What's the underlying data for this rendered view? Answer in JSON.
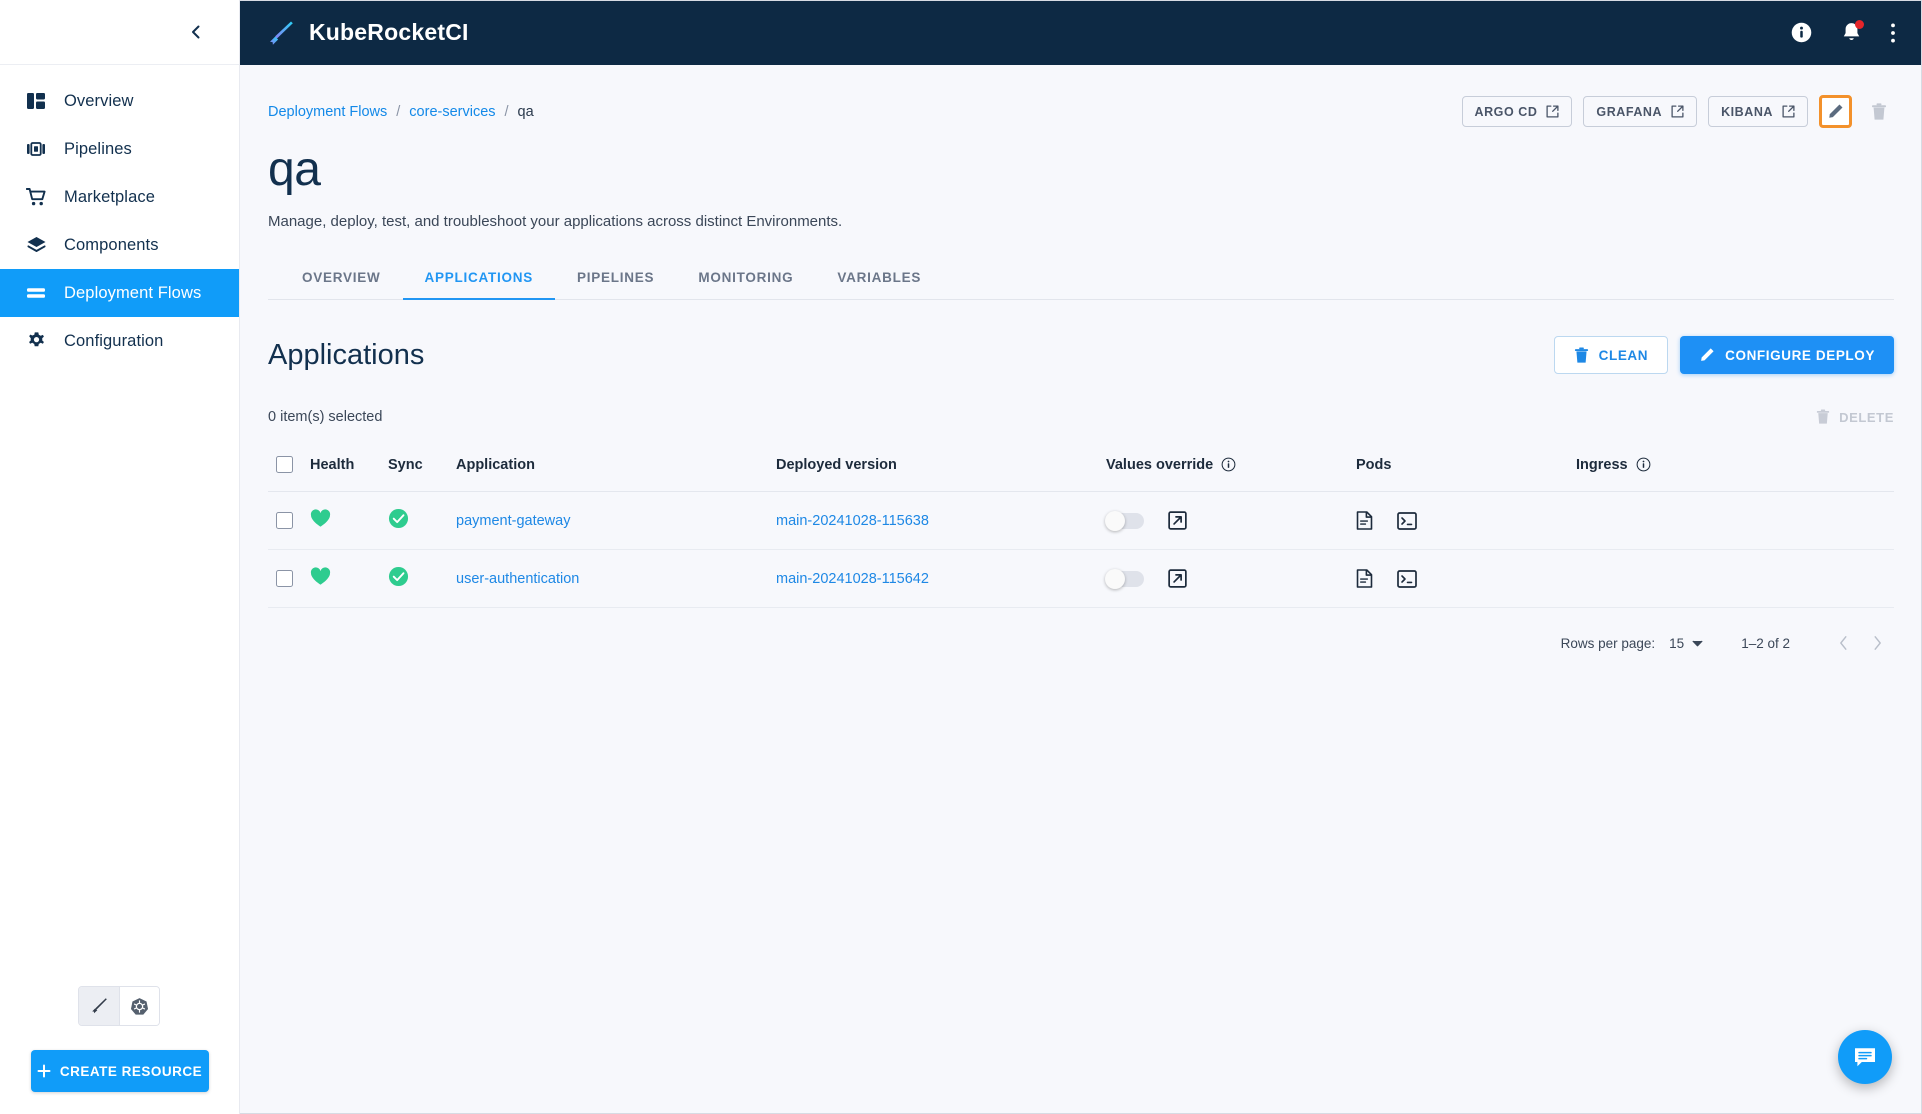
{
  "sidebar": {
    "collapse_icon": "chevron-left-icon",
    "items": [
      {
        "label": "Overview",
        "icon": "dashboard-icon",
        "active": false
      },
      {
        "label": "Pipelines",
        "icon": "pipelines-icon",
        "active": false
      },
      {
        "label": "Marketplace",
        "icon": "cart-icon",
        "active": false
      },
      {
        "label": "Components",
        "icon": "layers-icon",
        "active": false
      },
      {
        "label": "Deployment Flows",
        "icon": "deployment-flows-icon",
        "active": true
      },
      {
        "label": "Configuration",
        "icon": "gear-icon",
        "active": false
      }
    ],
    "mode_buttons": [
      {
        "name": "krci-mode-button",
        "icon": "rocket-pen-icon",
        "selected": true
      },
      {
        "name": "kubernetes-mode-button",
        "icon": "kubernetes-icon",
        "selected": false
      }
    ],
    "create_resource_label": "CREATE RESOURCE"
  },
  "topbar": {
    "brand": "KubeRocketCI",
    "logo_icon": "rocket-pen-icon",
    "icons": [
      {
        "name": "info-icon",
        "badge": false
      },
      {
        "name": "notifications-bell-icon",
        "badge": true
      },
      {
        "name": "more-vertical-icon",
        "badge": false
      }
    ]
  },
  "breadcrumb": {
    "items": [
      {
        "label": "Deployment Flows",
        "link": true
      },
      {
        "label": "core-services",
        "link": true
      },
      {
        "label": "qa",
        "link": false
      }
    ],
    "separator": "/"
  },
  "page_actions": {
    "links": [
      {
        "label": "ARGO CD",
        "icon": "external-link-icon"
      },
      {
        "label": "GRAFANA",
        "icon": "external-link-icon"
      },
      {
        "label": "KIBANA",
        "icon": "external-link-icon"
      }
    ],
    "edit": {
      "name": "edit-pencil-button",
      "icon": "pencil-icon",
      "highlighted": true,
      "highlight_color": "#f3912b"
    },
    "delete": {
      "name": "delete-trash-button",
      "icon": "trash-icon",
      "disabled": true
    }
  },
  "page": {
    "title": "qa",
    "subtitle": "Manage, deploy, test, and troubleshoot your applications across distinct Environments."
  },
  "tabs": [
    {
      "label": "OVERVIEW",
      "active": false
    },
    {
      "label": "APPLICATIONS",
      "active": true
    },
    {
      "label": "PIPELINES",
      "active": false
    },
    {
      "label": "MONITORING",
      "active": false
    },
    {
      "label": "VARIABLES",
      "active": false
    }
  ],
  "applications_section": {
    "title": "Applications",
    "clean_label": "CLEAN",
    "clean_icon": "trash-icon",
    "configure_deploy_label": "CONFIGURE DEPLOY",
    "configure_deploy_icon": "pencil-icon",
    "selected_text": "0 item(s) selected",
    "delete_label": "DELETE",
    "delete_icon": "trash-icon"
  },
  "table": {
    "columns": [
      {
        "key": "check",
        "label": "",
        "info": false
      },
      {
        "key": "health",
        "label": "Health",
        "info": false
      },
      {
        "key": "sync",
        "label": "Sync",
        "info": false
      },
      {
        "key": "application",
        "label": "Application",
        "info": false
      },
      {
        "key": "version",
        "label": "Deployed version",
        "info": false
      },
      {
        "key": "values",
        "label": "Values override",
        "info": true
      },
      {
        "key": "pods",
        "label": "Pods",
        "info": false
      },
      {
        "key": "ingress",
        "label": "Ingress",
        "info": true
      }
    ],
    "rows": [
      {
        "selected": false,
        "health": "healthy",
        "health_icon": "heart-icon",
        "sync": "synced",
        "sync_icon": "check-circle-icon",
        "application": "payment-gateway",
        "deployed_version": "main-20241028-115638",
        "values_override": false,
        "values_external_icon": "external-link-icon",
        "pods_icons": [
          "document-icon",
          "terminal-icon"
        ],
        "ingress": ""
      },
      {
        "selected": false,
        "health": "healthy",
        "health_icon": "heart-icon",
        "sync": "synced",
        "sync_icon": "check-circle-icon",
        "application": "user-authentication",
        "deployed_version": "main-20241028-115642",
        "values_override": false,
        "values_external_icon": "external-link-icon",
        "pods_icons": [
          "document-icon",
          "terminal-icon"
        ],
        "ingress": ""
      }
    ]
  },
  "pagination": {
    "rows_per_page_label": "Rows per page:",
    "rows_per_page_value": "15",
    "range": "1–2 of 2",
    "prev_icon": "chevron-left-icon",
    "next_icon": "chevron-right-icon"
  },
  "fab": {
    "name": "chat-button",
    "icon": "chat-bubble-icon"
  },
  "colors": {
    "accent": "#109cf9",
    "topbar": "#0d2944",
    "healthy": "#2ecc8f",
    "highlight": "#f3912b",
    "background": "#f7f8fc"
  }
}
